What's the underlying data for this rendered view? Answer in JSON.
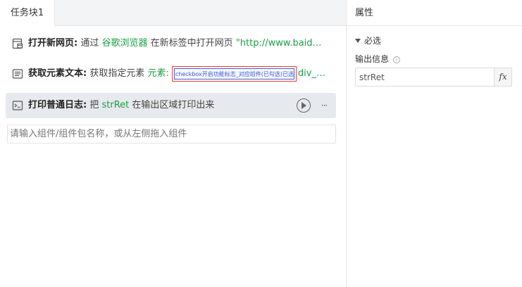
{
  "tabs": [
    {
      "label": "任务块1"
    }
  ],
  "steps": [
    {
      "title": "打开新网页:",
      "parts": [
        "通过",
        "谷歌浏览器",
        "在新标签中打开网页",
        "\"http://www.baid…"
      ]
    },
    {
      "title": "获取元素文本:",
      "parts": [
        "获取指定元素",
        "元素:",
        "div_…"
      ],
      "element_image_text": "checkbox开启功能标志_对应组件(已勾选)已选中的Input…"
    },
    {
      "title": "打印普通日志:",
      "parts": [
        "把",
        "strRet",
        "在输出区域打印出来"
      ],
      "selected": true,
      "more": "···"
    }
  ],
  "component_search": {
    "placeholder": "请输入组件/组件包名称，或从左侧拖入组件"
  },
  "properties": {
    "header": "属性",
    "section": "必选",
    "field_label": "输出信息",
    "info_icon": "ⓘ",
    "output_value": "strRet",
    "fx_label": "fx"
  },
  "colors": {
    "accent_green": "#1a9f45",
    "selected_row": "#e6e9ee",
    "element_border": "#e13c3c"
  },
  "icons": [
    "browser-page-icon",
    "element-text-icon",
    "terminal-log-icon",
    "play-icon",
    "more-icon",
    "info-icon",
    "fx-icon",
    "caret-down-icon"
  ]
}
